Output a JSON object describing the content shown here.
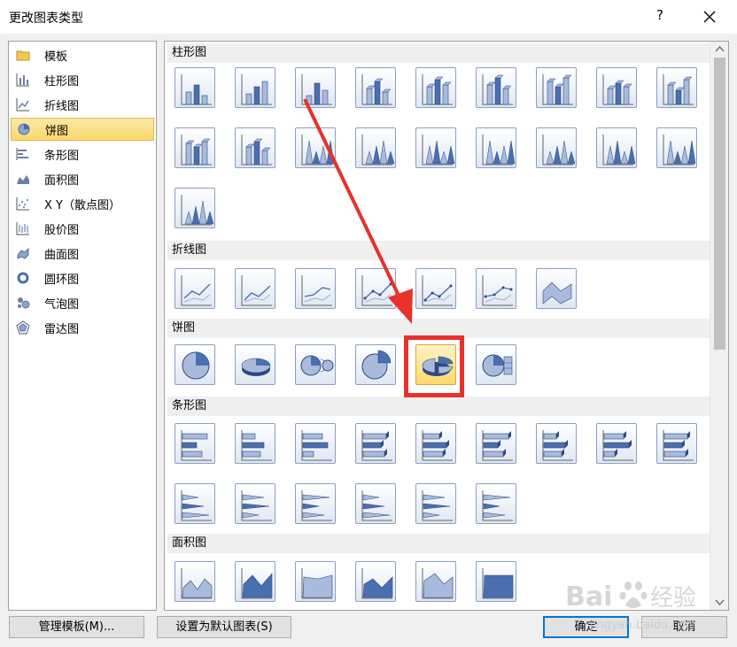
{
  "dialog": {
    "title": "更改图表类型",
    "help_label": "?"
  },
  "categories": [
    {
      "label": "模板",
      "icon": "folder-icon"
    },
    {
      "label": "柱形图",
      "icon": "column-chart-icon"
    },
    {
      "label": "折线图",
      "icon": "line-chart-icon"
    },
    {
      "label": "饼图",
      "icon": "pie-chart-icon",
      "selected": true
    },
    {
      "label": "条形图",
      "icon": "bar-chart-icon"
    },
    {
      "label": "面积图",
      "icon": "area-chart-icon"
    },
    {
      "label": "X Y（散点图）",
      "icon": "scatter-chart-icon"
    },
    {
      "label": "股价图",
      "icon": "stock-chart-icon"
    },
    {
      "label": "曲面图",
      "icon": "surface-chart-icon"
    },
    {
      "label": "圆环图",
      "icon": "doughnut-chart-icon"
    },
    {
      "label": "气泡图",
      "icon": "bubble-chart-icon"
    },
    {
      "label": "雷达图",
      "icon": "radar-chart-icon"
    }
  ],
  "sections": [
    {
      "title": "柱形图",
      "thumbnail_count": 19
    },
    {
      "title": "折线图",
      "thumbnail_count": 7
    },
    {
      "title": "饼图",
      "thumbnail_count": 6,
      "selected_index": 4
    },
    {
      "title": "条形图",
      "thumbnail_count": 15
    },
    {
      "title": "面积图",
      "thumbnail_count": 6
    }
  ],
  "buttons": {
    "manage_templates": "管理模板(M)...",
    "set_default": "设置为默认图表(S)",
    "ok": "确定",
    "cancel": "取消"
  },
  "watermark": {
    "brand": "Bai",
    "brand_suffix": "经验",
    "url": "jingyan.baidu.com"
  },
  "colors": {
    "accent": "#0078d7",
    "highlight_red": "#e8312b",
    "selected_bg": "#fbd86c",
    "thumb_blue": "#4a6fb0"
  }
}
